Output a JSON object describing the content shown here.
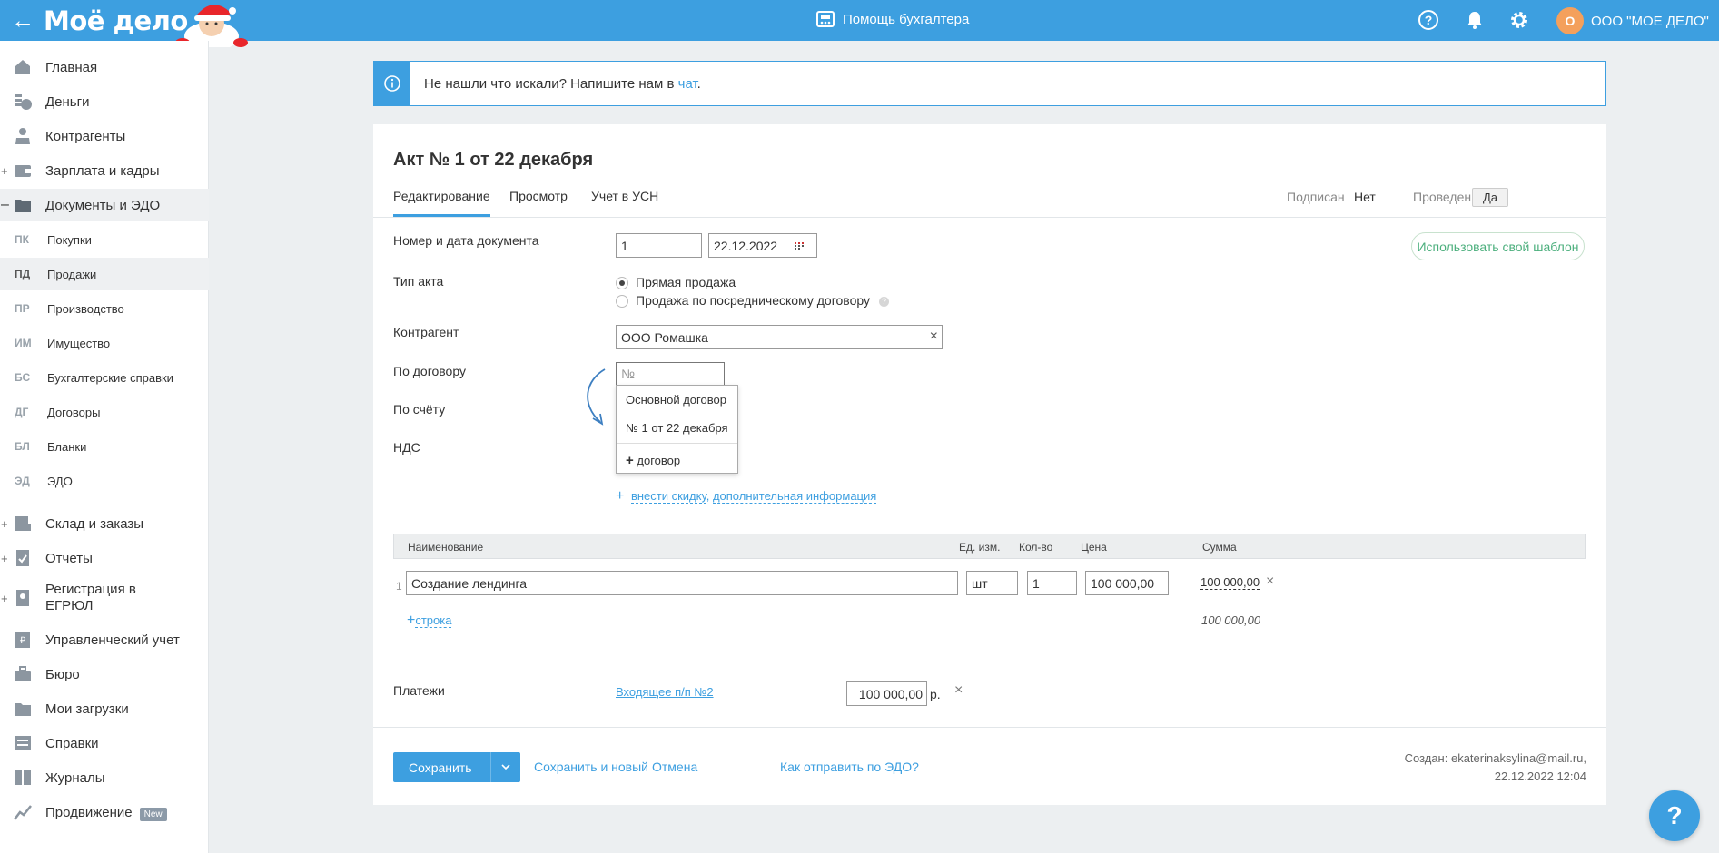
{
  "header": {
    "logo": "Моё дело",
    "helper": "Помощь бухгалтера",
    "company_initial": "О",
    "company": "ООО \"МОЕ ДЕЛО\""
  },
  "sidebar": {
    "items": [
      {
        "label": "Главная",
        "icon": "home-icon"
      },
      {
        "label": "Деньги",
        "icon": "money-icon"
      },
      {
        "label": "Контрагенты",
        "icon": "contractors-icon"
      },
      {
        "label": "Зарплата и кадры",
        "icon": "wallet-icon"
      },
      {
        "label": "Документы и ЭДО",
        "icon": "folder-icon"
      },
      {
        "label": "Склад и заказы",
        "icon": "warehouse-icon"
      },
      {
        "label": "Отчеты",
        "icon": "reports-icon"
      },
      {
        "label": "Регистрация в",
        "label2": "ЕГРЮЛ",
        "icon": "registration-icon"
      },
      {
        "label": "Управленческий учет",
        "icon": "management-icon"
      },
      {
        "label": "Бюро",
        "icon": "briefcase-icon"
      },
      {
        "label": "Мои загрузки",
        "icon": "downloads-icon"
      },
      {
        "label": "Справки",
        "icon": "certificates-icon"
      },
      {
        "label": "Журналы",
        "icon": "journals-icon"
      },
      {
        "label": "Продвижение",
        "icon": "promotion-icon",
        "badge": "New"
      }
    ],
    "sub_items": [
      {
        "abbr": "ПК",
        "label": "Покупки"
      },
      {
        "abbr": "ПД",
        "label": "Продажи"
      },
      {
        "abbr": "ПР",
        "label": "Производство"
      },
      {
        "abbr": "ИМ",
        "label": "Имущество"
      },
      {
        "abbr": "БС",
        "label": "Бухгалтерские справки"
      },
      {
        "abbr": "ДГ",
        "label": "Договоры"
      },
      {
        "abbr": "БЛ",
        "label": "Бланки"
      },
      {
        "abbr": "ЭД",
        "label": "ЭДО"
      }
    ],
    "plus": "+",
    "minus": "–"
  },
  "infobar": {
    "text": "Не нашли что искали? Напишите нам в ",
    "link": "чат",
    "end": "."
  },
  "doc": {
    "title": "Акт № 1 от 22 декабря",
    "tabs": [
      "Редактирование",
      "Просмотр",
      "Учет в УСН"
    ],
    "signed_label": "Подписан",
    "signed_value": "Нет",
    "posted_label": "Проведен",
    "posted_value": "Да",
    "template_button": "Использовать свой шаблон"
  },
  "form": {
    "number_date_label": "Номер и дата документа",
    "number": "1",
    "date": "22.12.2022",
    "act_type_label": "Тип акта",
    "act_type_options": [
      "Прямая продажа",
      "Продажа по посредническому договору"
    ],
    "contractor_label": "Контрагент",
    "contractor": "ООО Ромашка",
    "contract_label": "По договору",
    "contract_placeholder": "№",
    "invoice_label": "По счёту",
    "vat_label": "НДС",
    "discount_link": "внести скидку",
    "comma": ",",
    "extra_link": "дополнительная информация"
  },
  "dropdown": {
    "options": [
      "Основной договор",
      "№ 1 от 22 декабря"
    ],
    "add": "договор"
  },
  "table": {
    "headers": [
      "Наименование",
      "Ед. изм.",
      "Кол-во",
      "Цена",
      "Сумма"
    ],
    "rows": [
      {
        "num": "1",
        "name": "Создание лендинга",
        "unit": "шт",
        "qty": "1",
        "price": "100 000,00",
        "sum": "100 000,00"
      }
    ],
    "add_row": "строка",
    "total": "100 000,00"
  },
  "payments": {
    "label": "Платежи",
    "link": "Входящее п/п №2",
    "amount": "100 000,00",
    "unit": "р."
  },
  "footer": {
    "save": "Сохранить",
    "save_new": "Сохранить и новый",
    "cancel": "Отмена",
    "edo_link": "Как отправить по ЭДО?",
    "created_line1": "Создан: ekaterinaksylina@mail.ru,",
    "created_line2": "22.12.2022 12:04"
  },
  "colors": {
    "accent": "#3d9fe0",
    "header": "#3d9fe0",
    "avatar": "#f4a05c",
    "template_button": "#4caf7d"
  }
}
